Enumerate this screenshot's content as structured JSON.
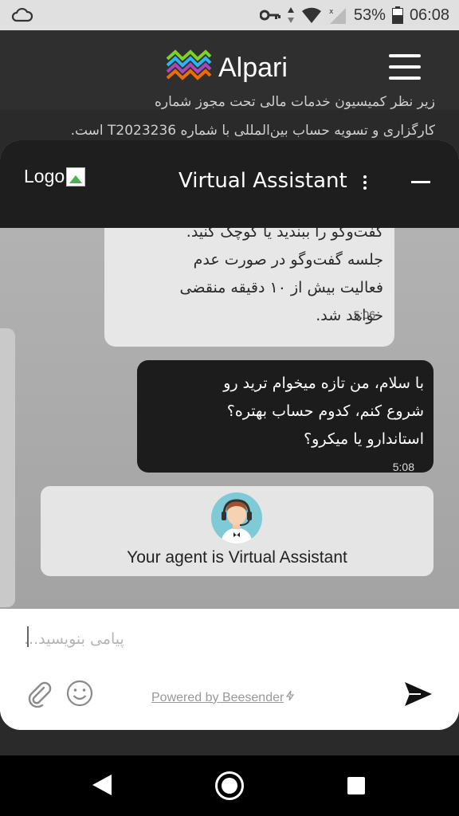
{
  "status_bar": {
    "battery": "53%",
    "time": "06:08"
  },
  "site_header": {
    "brand": "Alpari",
    "background_text_line1": "زیر نظر کمیسیون خدمات مالی تحت مجوز شماره",
    "background_text_line2": "کارگزاری و تسویه حساب بین‌المللی با شماره T2023236 است."
  },
  "widget": {
    "logo_alt": "Logo",
    "title": "Virtual Assistant"
  },
  "messages": [
    {
      "direction": "incoming",
      "lines": [
        "گفت‌وگو را ببندید یا کوچک کنید.",
        "جلسه گفت‌وگو در صورت عدم",
        "فعالیت بیش از ۱۰ دقیقه منقضی",
        "خواهد شد."
      ],
      "time": "5:06"
    },
    {
      "direction": "outgoing",
      "lines": [
        "با سلام، من تازه میخوام ترید رو",
        "شروع کنم، کدوم حساب بهتره؟",
        "استاندارو یا میکرو؟"
      ],
      "time": "5:08"
    }
  ],
  "agent_card": {
    "text": "Your agent is Virtual Assistant"
  },
  "composer": {
    "placeholder": "پیامی بنویسید...",
    "powered_by": "Powered by Beesender"
  },
  "colors": {
    "header_bg": "#2f2f2f",
    "widget_header_bg": "#1e1e1e",
    "incoming_bubble": "#e7e7e7",
    "outgoing_bubble": "#1c1c1c",
    "agent_avatar_bg": "#7ecad6"
  }
}
